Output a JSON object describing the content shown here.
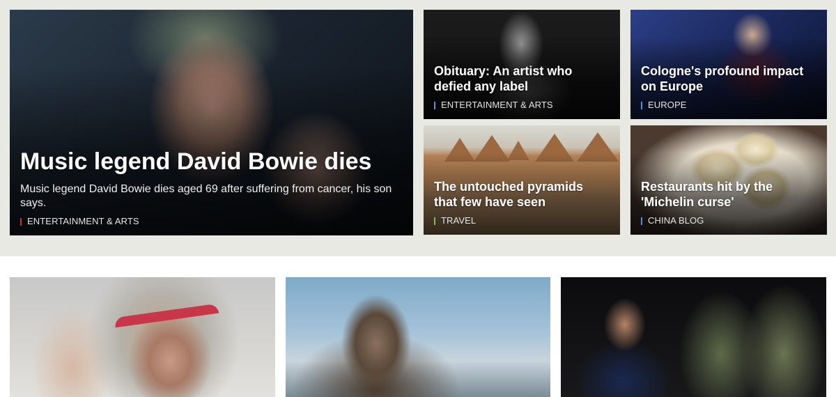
{
  "colors": {
    "band_background": "#e9e9e4",
    "tag_bar_hero": "#c0392b",
    "tag_bar_default": "#5b8fd8",
    "tag_bar_travel": "#7fbf4d"
  },
  "hero": {
    "headline": "Music legend David Bowie dies",
    "summary": "Music legend David Bowie dies aged 69 after suffering from cancer, his son says.",
    "tag": "ENTERTAINMENT & ARTS"
  },
  "cards": [
    {
      "headline": "Obituary: An artist who defied any label",
      "tag": "ENTERTAINMENT & ARTS"
    },
    {
      "headline": "Cologne's profound impact on Europe",
      "tag": "EUROPE"
    },
    {
      "headline": "The untouched pyramids that few have seen",
      "tag": "TRAVEL"
    },
    {
      "headline": "Restaurants hit by the 'Michelin curse'",
      "tag": "CHINA BLOG"
    }
  ]
}
